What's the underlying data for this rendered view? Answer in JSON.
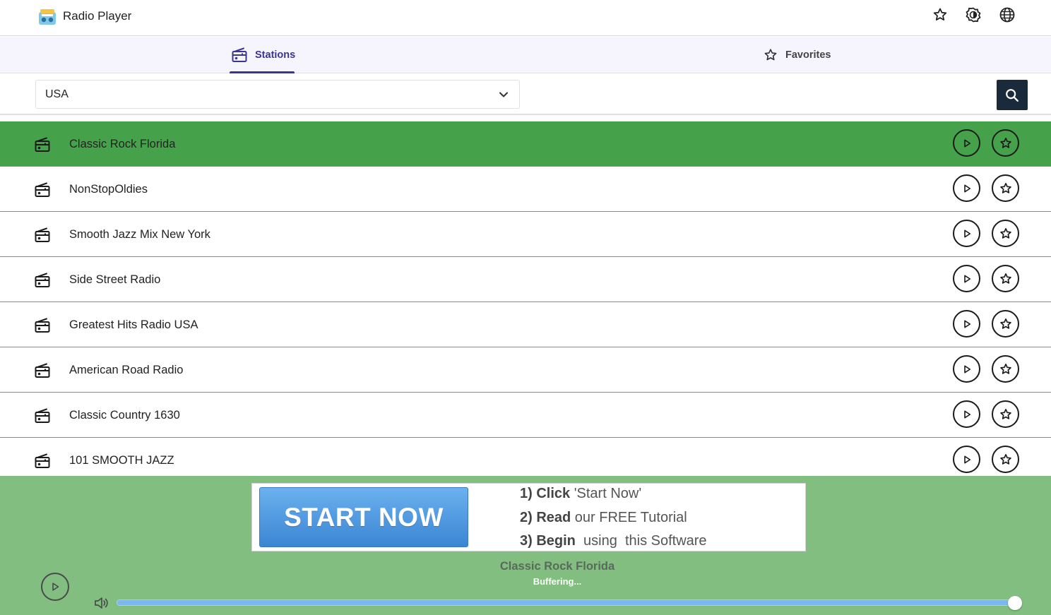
{
  "app": {
    "title": "Radio Player"
  },
  "header": {
    "icons": [
      "star-outline-icon",
      "brightness-icon",
      "globe-icon"
    ]
  },
  "tabs": [
    {
      "label": "Stations",
      "icon": "radio-icon",
      "active": true
    },
    {
      "label": "Favorites",
      "icon": "star-outline-icon",
      "active": false
    }
  ],
  "search": {
    "country": "USA"
  },
  "stations": [
    {
      "name": "Classic Rock Florida",
      "selected": true
    },
    {
      "name": "NonStopOldies",
      "selected": false
    },
    {
      "name": "Smooth Jazz Mix New York",
      "selected": false
    },
    {
      "name": "Side Street Radio",
      "selected": false
    },
    {
      "name": "Greatest Hits Radio USA",
      "selected": false
    },
    {
      "name": "American Road Radio",
      "selected": false
    },
    {
      "name": "Classic Country 1630",
      "selected": false
    },
    {
      "name": "101 SMOOTH JAZZ",
      "selected": false
    }
  ],
  "ad": {
    "button": "START NOW",
    "step1_bold": "1) Click",
    "step1_rest": " 'Start Now'",
    "step2_bold": "2) Read",
    "step2_rest": " our FREE Tutorial",
    "step3_bold": "3) Begin",
    "step3_rest": "  using  this Software"
  },
  "player": {
    "station": "Classic Rock Florida",
    "status": "Buffering...",
    "volume": 1.0
  },
  "colors": {
    "accent": "#3a3494",
    "selected_row": "#46a24a",
    "player_bg": "#81be80",
    "search_button": "#1b2a3a"
  }
}
